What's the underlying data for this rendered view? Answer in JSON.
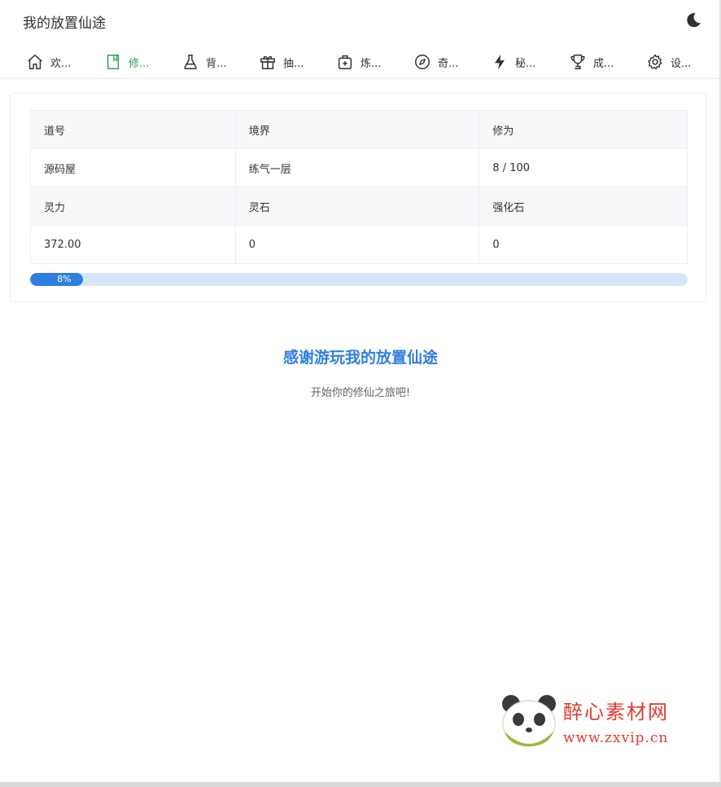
{
  "header": {
    "title": "我的放置仙途",
    "theme_icon": "moon-icon"
  },
  "nav": [
    {
      "label": "欢...",
      "icon": "home-icon"
    },
    {
      "label": "修...",
      "icon": "book-icon",
      "active": true,
      "color": "#2e9e5b"
    },
    {
      "label": "背...",
      "icon": "flask-icon"
    },
    {
      "label": "抽...",
      "icon": "gift-icon"
    },
    {
      "label": "炼...",
      "icon": "medkit-icon"
    },
    {
      "label": "奇...",
      "icon": "compass-icon"
    },
    {
      "label": "秘...",
      "icon": "lightning-icon"
    },
    {
      "label": "成...",
      "icon": "trophy-icon"
    },
    {
      "label": "设...",
      "icon": "gear-icon"
    }
  ],
  "stats": {
    "row1": {
      "labels": [
        "道号",
        "境界",
        "修为"
      ],
      "values": [
        "源码屋",
        "练气一层",
        "8 / 100"
      ]
    },
    "row2": {
      "labels": [
        "灵力",
        "灵石",
        "强化石"
      ],
      "values": [
        "372.00",
        "0",
        "0"
      ]
    }
  },
  "progress": {
    "percent": 8,
    "label": "8%",
    "color": "#2f7fe0",
    "track_color": "#d6e6f8"
  },
  "main": {
    "thanks": "感谢游玩我的放置仙途",
    "subtitle": "开始你的修仙之旅吧!"
  },
  "watermark": {
    "brand": "醉心素材网",
    "url": "www.zxvip.cn",
    "color": "#e23a2e"
  }
}
